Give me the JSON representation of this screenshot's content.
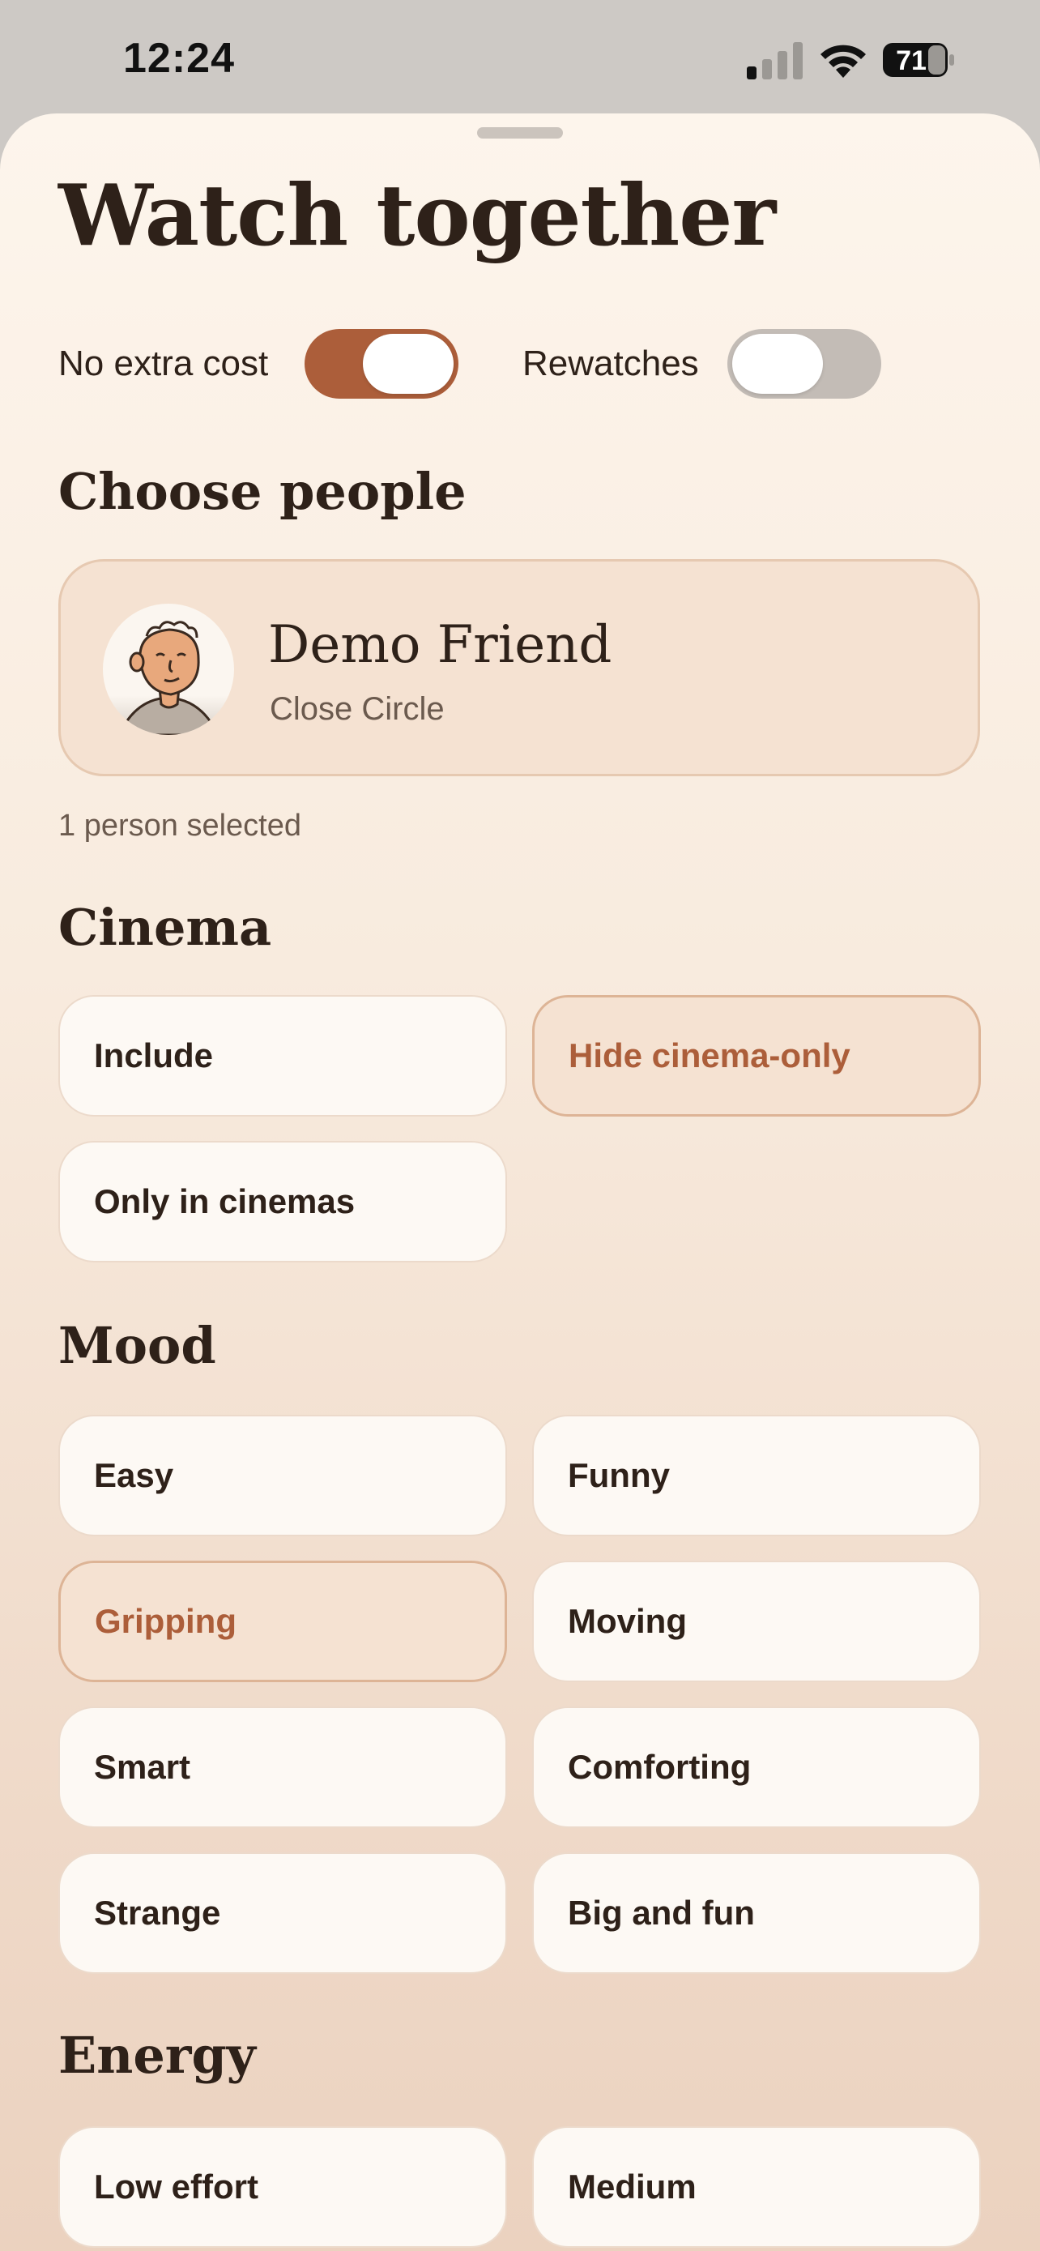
{
  "status_bar": {
    "time": "12:24",
    "battery_level": "71"
  },
  "sheet": {
    "title": "Watch together",
    "toggles": [
      {
        "label": "No extra cost",
        "on": true
      },
      {
        "label": "Rewatches",
        "on": false
      }
    ],
    "people": {
      "heading": "Choose people",
      "person": {
        "name": "Demo Friend",
        "group": "Close Circle"
      },
      "selected_count": "1 person selected"
    },
    "cinema": {
      "heading": "Cinema",
      "options": [
        "Include",
        "Hide cinema-only",
        "Only in cinemas"
      ],
      "selected": "Hide cinema-only"
    },
    "mood": {
      "heading": "Mood",
      "options": [
        "Easy",
        "Funny",
        "Gripping",
        "Moving",
        "Smart",
        "Comforting",
        "Strange",
        "Big and fun"
      ],
      "selected": "Gripping"
    },
    "energy": {
      "heading": "Energy",
      "options": [
        "Low effort",
        "Medium"
      ]
    }
  },
  "colors": {
    "accent": "#ac5e3a",
    "selected_bg": "#f5e2d2",
    "text": "#2e2119"
  }
}
